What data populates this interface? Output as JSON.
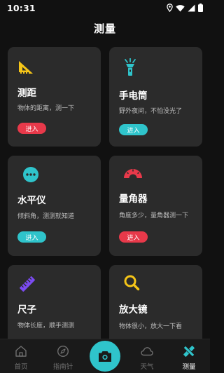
{
  "status_bar": {
    "time": "10:31",
    "icons": [
      "location-icon",
      "wifi-icon",
      "cellular-signal-icon",
      "battery-icon"
    ]
  },
  "header": {
    "title": "测量"
  },
  "colors": {
    "red": "#e8394a",
    "cyan": "#2fc4cb",
    "yellow": "#f5c518",
    "pink": "#e8394a",
    "purple": "#7b4bf2",
    "card_bg": "#2b2b2b"
  },
  "cards": [
    {
      "icon": "ruler-angle-icon",
      "title": "测距",
      "desc": "物体的距离，测一下",
      "button": "进入",
      "button_color": "red"
    },
    {
      "icon": "flashlight-icon",
      "title": "手电筒",
      "desc": "野外夜间，不怕没光了",
      "button": "进入",
      "button_color": "cyan"
    },
    {
      "icon": "level-icon",
      "title": "水平仪",
      "desc": "倾斜角，测测就知道",
      "button": "进入",
      "button_color": "cyan"
    },
    {
      "icon": "protractor-icon",
      "title": "量角器",
      "desc": "角度多少，量角器测一下",
      "button": "进入",
      "button_color": "red"
    },
    {
      "icon": "ruler-icon",
      "title": "尺子",
      "desc": "物体长度，顺手测测"
    },
    {
      "icon": "magnifier-icon",
      "title": "放大镜",
      "desc": "物体很小，放大一下看"
    }
  ],
  "bottom_nav": {
    "items": [
      {
        "icon": "home-icon",
        "label": "首页",
        "active": false
      },
      {
        "icon": "compass-icon",
        "label": "指南针",
        "active": false
      },
      {
        "icon": "camera-icon",
        "label": "",
        "active": false
      },
      {
        "icon": "weather-cloud-icon",
        "label": "天气",
        "active": false
      },
      {
        "icon": "measure-tools-icon",
        "label": "测量",
        "active": true
      }
    ]
  }
}
